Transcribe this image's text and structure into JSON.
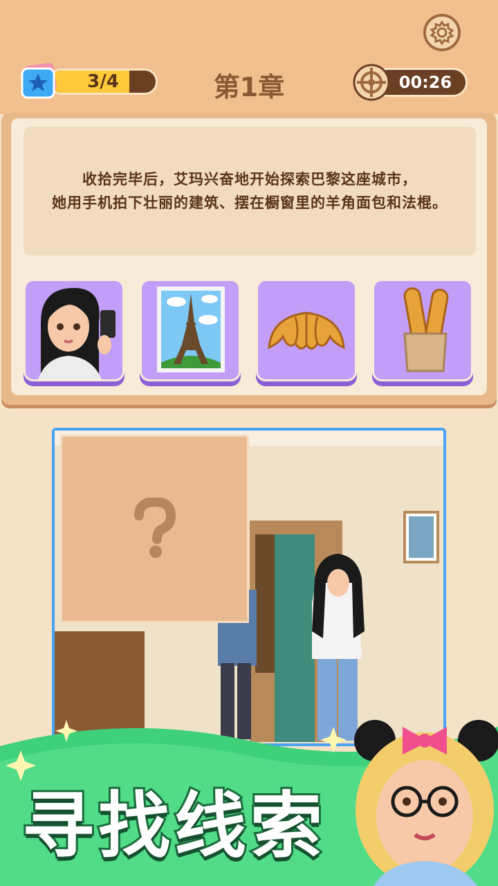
{
  "header": {
    "progress_text": "3/4",
    "progress_fraction": 0.75,
    "chapter_title": "第1章",
    "timer_text": "00:26",
    "settings_icon": "gear-icon",
    "progress_icon": "star-icon",
    "timer_icon": "target-icon"
  },
  "story": {
    "line1": "收拾完毕后，艾玛兴奋地开始探索巴黎这座城市，",
    "line2": "她用手机拍下壮丽的建筑、摆在橱窗里的羊角面包和法棍。"
  },
  "clue_cards": [
    {
      "name": "woman-with-phone"
    },
    {
      "name": "eiffel-tower-photo"
    },
    {
      "name": "croissant"
    },
    {
      "name": "baguettes"
    }
  ],
  "scene": {
    "mystery_symbol": "?"
  },
  "banner": {
    "title": "寻找线索"
  },
  "colors": {
    "accent_purple": "#c39ef8",
    "banner_green": "#3ed07a",
    "frame_blue": "#4aa3f2",
    "progress_yellow": "#ffc93a"
  }
}
